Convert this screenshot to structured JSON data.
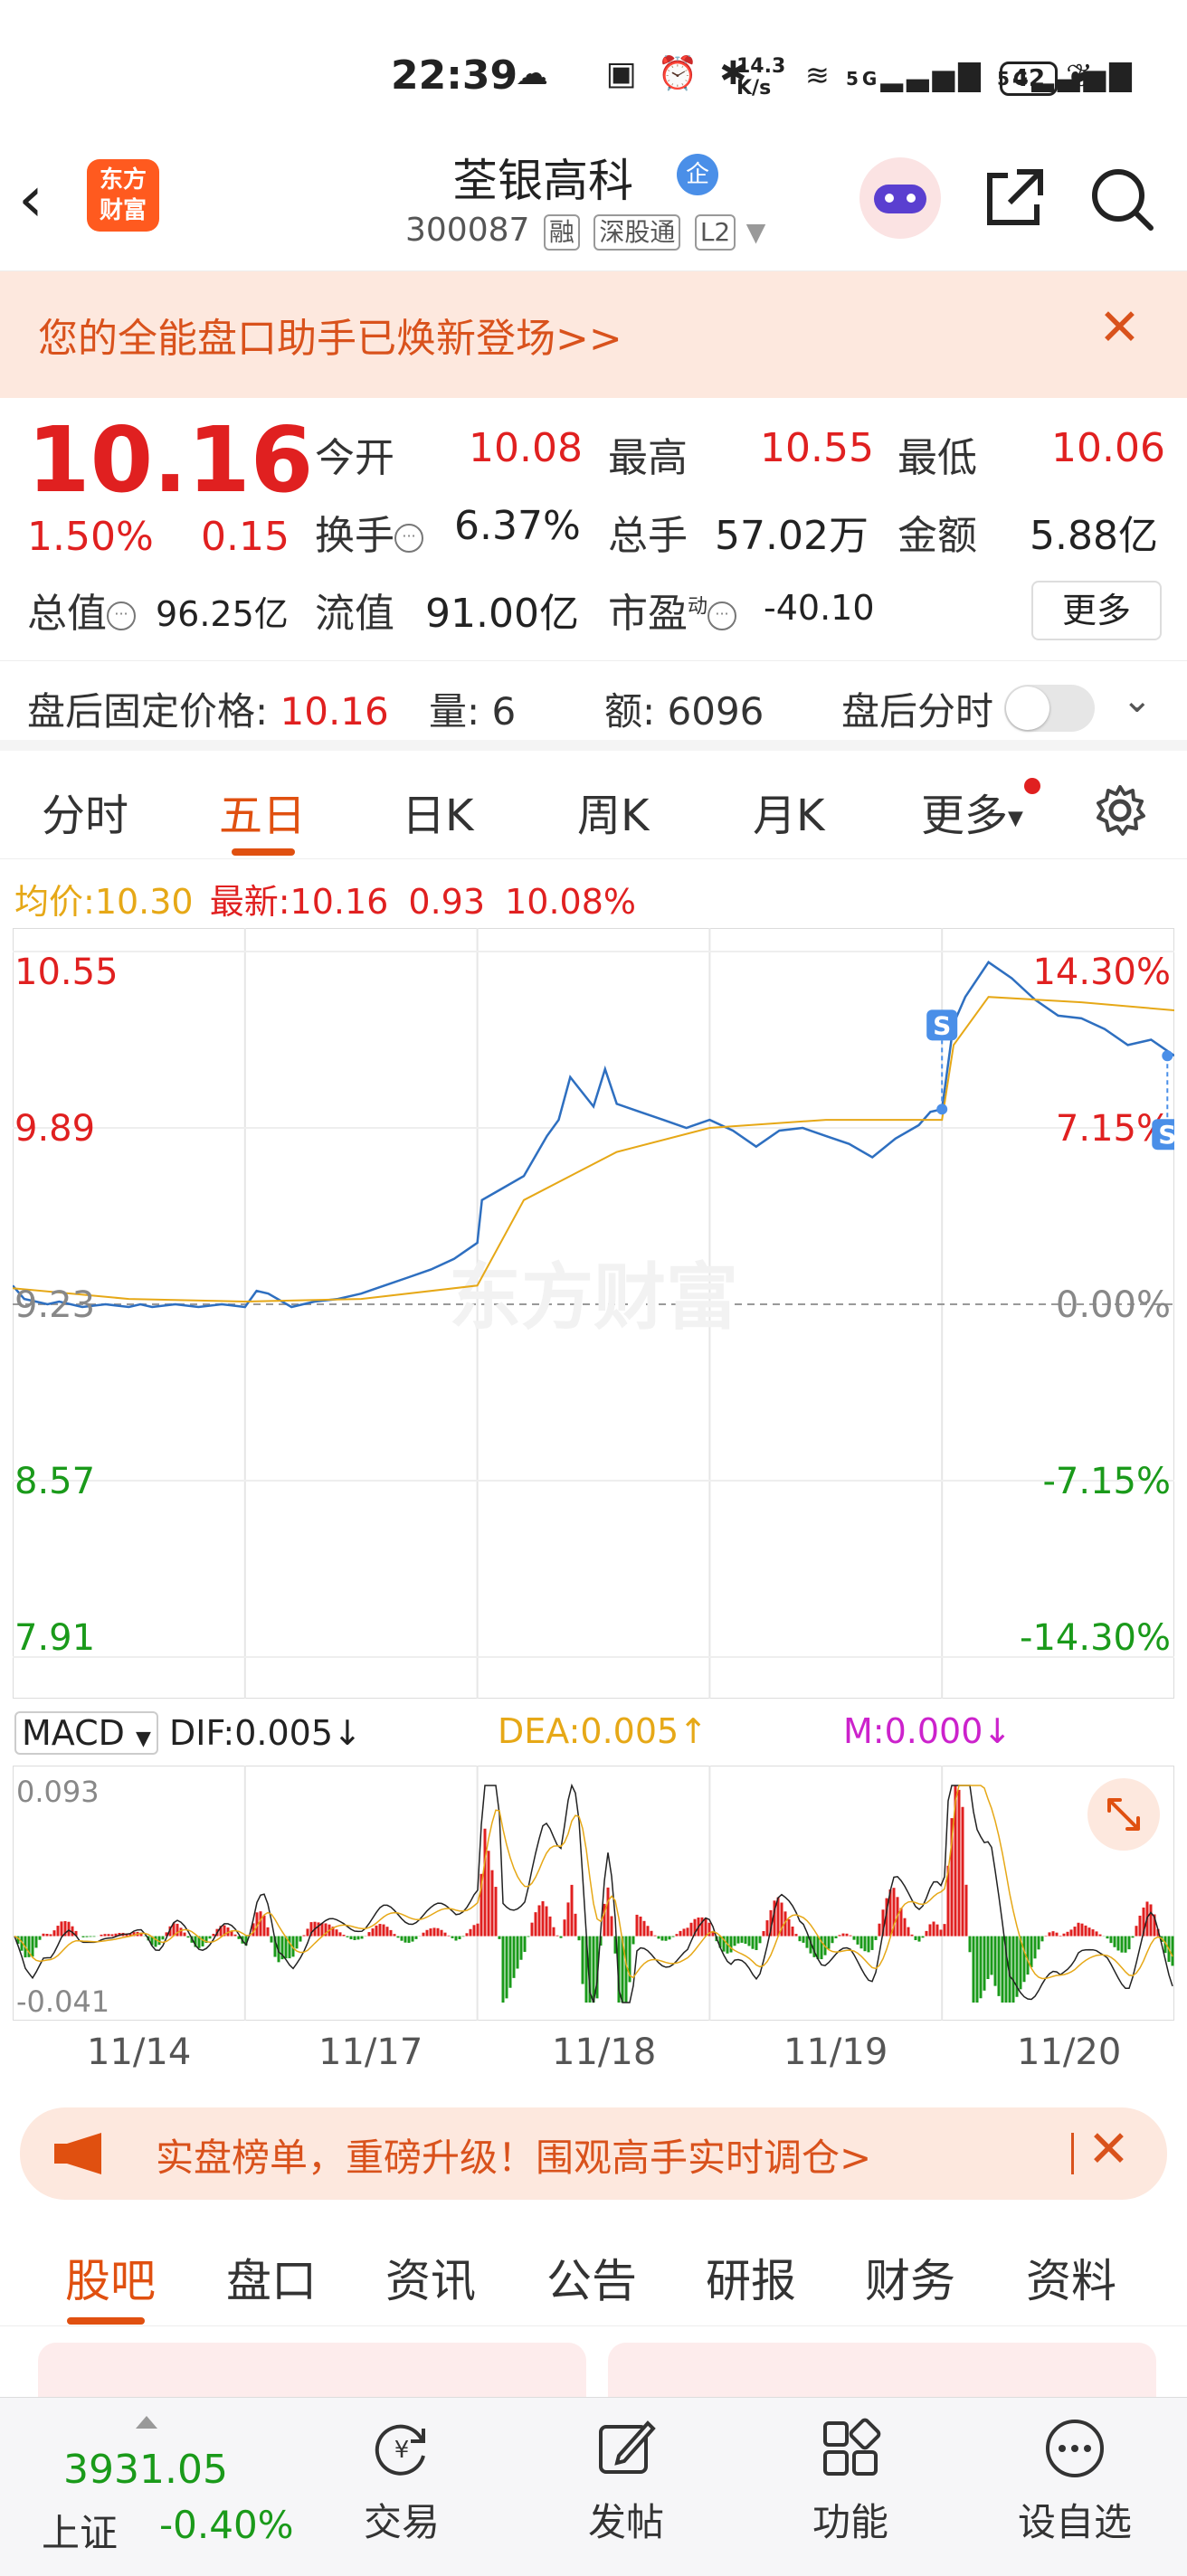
{
  "status": {
    "time": "22:39",
    "net_speed": "14.3 K/s",
    "battery": "42"
  },
  "header": {
    "logo_text": "东方财富",
    "title": "荃银高科",
    "verified_badge": "企",
    "code": "300087",
    "tags": [
      "融",
      "深股通",
      "L2"
    ]
  },
  "banner": {
    "text": "您的全能盘口助手已焕新登场>>"
  },
  "quote": {
    "price": "10.16",
    "change_pct": "1.50%",
    "change": "0.15",
    "open_label": "今开",
    "open": "10.08",
    "high_label": "最高",
    "high": "10.55",
    "low_label": "最低",
    "low": "10.06",
    "turnover_label": "换手",
    "turnover": "6.37%",
    "volume_label": "总手",
    "volume": "57.02万",
    "amount_label": "金额",
    "amount": "5.88亿",
    "mktcap_label": "总值",
    "mktcap": "96.25亿",
    "float_label": "流值",
    "float": "91.00亿",
    "pe_label": "市盈",
    "pe_sup": "动",
    "pe": "-40.10",
    "more": "更多"
  },
  "afterhours": {
    "price_label": "盘后固定价格:",
    "price": "10.16",
    "vol_label": "量:",
    "vol": "6",
    "amt_label": "额:",
    "amt": "6096",
    "toggle_label": "盘后分时"
  },
  "chart_tabs": [
    "分时",
    "五日",
    "日K",
    "周K",
    "月K",
    "更多"
  ],
  "price_summary": {
    "avg_label": "均价:",
    "avg": "10.30",
    "latest_label": "最新:",
    "latest": "10.16",
    "chg": "0.93",
    "chg_pct": "10.08%"
  },
  "chart_data": [
    {
      "type": "line",
      "title": "",
      "x_categories": [
        "11/14",
        "11/17",
        "11/18",
        "11/19",
        "11/20"
      ],
      "y_ticks_left": [
        "10.55",
        "9.89",
        "9.23",
        "8.57",
        "7.91"
      ],
      "y_ticks_right": [
        "14.30%",
        "7.15%",
        "0.00%",
        "-7.15%",
        "-14.30%"
      ],
      "ylim": [
        7.91,
        10.55
      ],
      "baseline": 9.23,
      "watermark": "东方财富",
      "series": [
        {
          "color": "#2e6fc0",
          "x": [
            0,
            0.05,
            0.1,
            0.15,
            0.2,
            0.3,
            0.4,
            0.5,
            0.55,
            0.6,
            0.7,
            0.8,
            0.9,
            1.0,
            1.05,
            1.1,
            1.2,
            1.3,
            1.4,
            1.5,
            1.6,
            1.7,
            1.8,
            1.9,
            2.0,
            2.02,
            2.1,
            2.2,
            2.3,
            2.35,
            2.4,
            2.5,
            2.55,
            2.6,
            2.7,
            2.8,
            2.9,
            3.0,
            3.1,
            3.2,
            3.3,
            3.4,
            3.5,
            3.6,
            3.7,
            3.8,
            3.9,
            3.95,
            4.0,
            4.05,
            4.1,
            4.2,
            4.3,
            4.4,
            4.5,
            4.6,
            4.7,
            4.8,
            4.9,
            5.0
          ],
          "y": [
            9.3,
            9.25,
            9.24,
            9.23,
            9.24,
            9.22,
            9.23,
            9.22,
            9.23,
            9.22,
            9.23,
            9.22,
            9.23,
            9.22,
            9.28,
            9.27,
            9.22,
            9.24,
            9.25,
            9.27,
            9.3,
            9.33,
            9.36,
            9.4,
            9.46,
            9.62,
            9.66,
            9.71,
            9.86,
            9.92,
            10.08,
            9.97,
            10.11,
            9.98,
            9.95,
            9.92,
            9.89,
            9.92,
            9.88,
            9.82,
            9.88,
            9.89,
            9.86,
            9.83,
            9.78,
            9.85,
            9.9,
            9.95,
            9.96,
            10.28,
            10.38,
            10.51,
            10.45,
            10.37,
            10.31,
            10.3,
            10.26,
            10.2,
            10.22,
            10.16
          ]
        },
        {
          "color": "#e6a817",
          "x": [
            0,
            0.5,
            1.0,
            1.5,
            2.0,
            2.2,
            2.6,
            3.0,
            3.5,
            4.0,
            4.05,
            4.2,
            4.6,
            5.0
          ],
          "y": [
            9.29,
            9.25,
            9.24,
            9.25,
            9.3,
            9.62,
            9.8,
            9.89,
            9.92,
            9.92,
            10.2,
            10.38,
            10.36,
            10.33
          ]
        }
      ]
    },
    {
      "type": "bar",
      "title": "MACD",
      "y_ticks": [
        "0.093",
        "-0.041"
      ],
      "ylim": [
        -0.041,
        0.093
      ],
      "legend": [
        "DIF:0.005↓",
        "DEA:0.005↑",
        "M:0.000↓"
      ]
    }
  ],
  "macd": {
    "selector": "MACD",
    "dif": "DIF:0.005",
    "dea": "DEA:0.005",
    "m": "M:0.000",
    "dif_arrow": "↓",
    "dea_arrow": "↑",
    "m_arrow": "↓",
    "y_top": "0.093",
    "y_bottom": "-0.041"
  },
  "promo": {
    "text": "实盘榜单，重磅升级！围观高手实时调仓>"
  },
  "content_tabs": [
    "股吧",
    "盘口",
    "资讯",
    "公告",
    "研报",
    "财务",
    "资料"
  ],
  "bottom_nav": {
    "index_value": "3931.05",
    "index_name": "上证",
    "index_change": "-0.40%",
    "items": [
      "交易",
      "发帖",
      "功能",
      "设自选"
    ]
  },
  "colors": {
    "accent": "#e05010",
    "up": "#e02020",
    "down": "#1a9a1a",
    "avg_line": "#e6a817",
    "price_line": "#2e6fc0"
  }
}
